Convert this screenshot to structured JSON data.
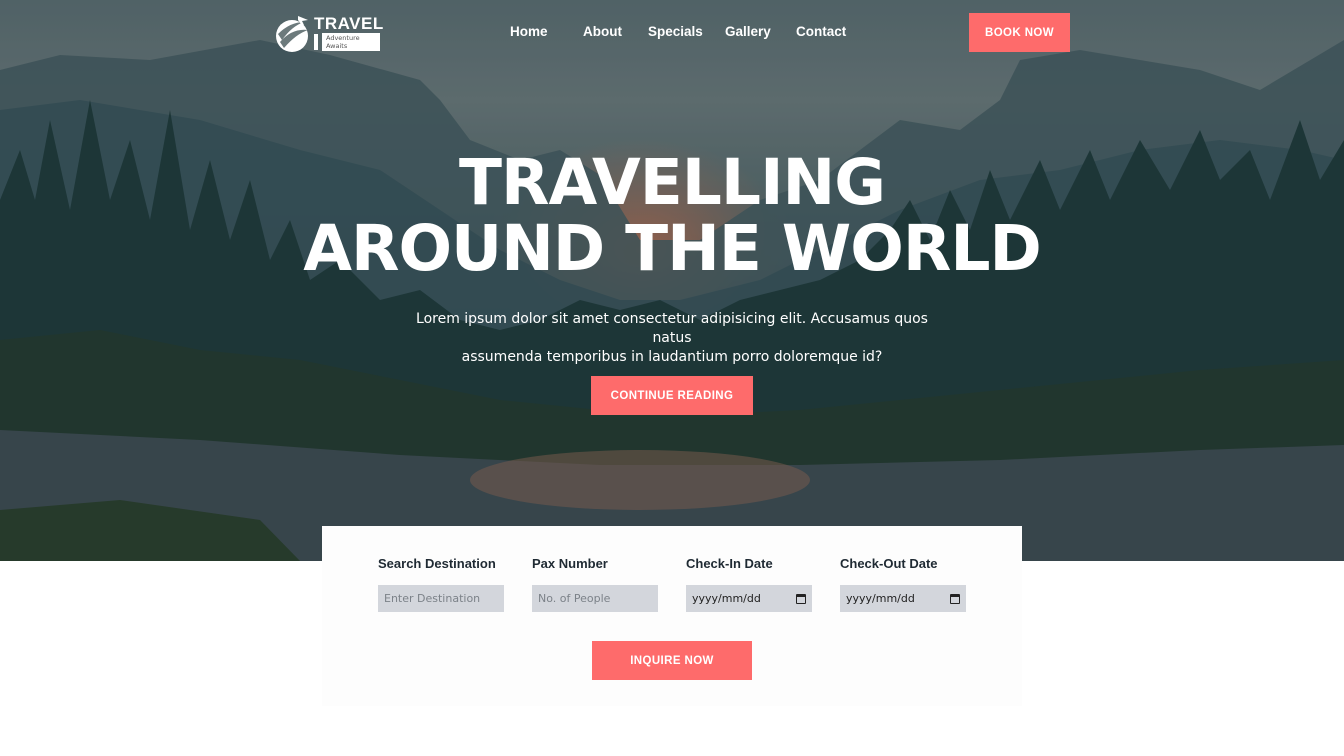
{
  "brand": {
    "name": "TRAVEL",
    "tagline": "Adventure Awaits"
  },
  "nav": {
    "items": [
      {
        "label": "Home"
      },
      {
        "label": "About"
      },
      {
        "label": "Specials"
      },
      {
        "label": "Gallery"
      },
      {
        "label": "Contact"
      }
    ],
    "cta_label": "BOOK NOW"
  },
  "hero": {
    "title_line1": "TRAVELLING",
    "title_line2": "AROUND THE WORLD",
    "subtitle_line1": "Lorem ipsum dolor sit amet consectetur adipisicing elit. Accusamus quos natus",
    "subtitle_line2": "assumenda temporibus in laudantium porro doloremque id?",
    "button_label": "CONTINUE READING"
  },
  "search": {
    "fields": [
      {
        "label": "Search Destination",
        "placeholder": "Enter Destination"
      },
      {
        "label": "Pax Number",
        "placeholder": "No. of People"
      },
      {
        "label": "Check-In Date",
        "value": "yyyy/mm/dd"
      },
      {
        "label": "Check-Out Date",
        "value": "yyyy/mm/dd"
      }
    ],
    "submit_label": "INQUIRE NOW"
  },
  "colors": {
    "accent": "#fe6b6b",
    "input_bg": "#d3d6dc",
    "label_text": "#1f2a33"
  },
  "icons": {
    "logo": "globe-plane-icon",
    "date_picker": "calendar-icon"
  }
}
